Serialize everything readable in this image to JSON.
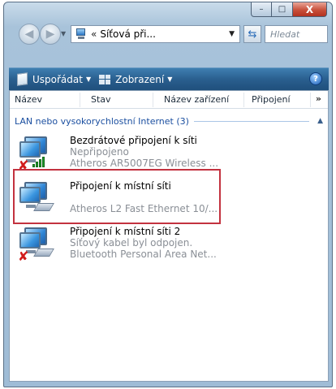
{
  "window": {
    "caption": {
      "minimize": "–",
      "maximize": "□",
      "close": "X"
    }
  },
  "address": {
    "separator": "«",
    "path": "Síťová při...",
    "search_placeholder": "Hledat"
  },
  "toolbar": {
    "organize": "Uspořádat",
    "views": "Zobrazení",
    "help": "?"
  },
  "columns": {
    "name": "Název",
    "status": "Stav",
    "device": "Název zařízení",
    "connection": "Připojení",
    "more": "»"
  },
  "group": {
    "label": "LAN nebo vysokorychlostní Internet (3)"
  },
  "items": [
    {
      "label": "Bezdrátové připojení k síti",
      "status": "Nepřipojeno",
      "device": "Atheros AR5007EG Wireless ...",
      "icon": "wireless-disconnected-icon"
    },
    {
      "label": "Připojení k místní síti",
      "status": "",
      "device": "Atheros L2 Fast Ethernet 10/...",
      "icon": "lan-connection-icon"
    },
    {
      "label": "Připojení k místní síti 2",
      "status": "Síťový kabel byl odpojen.",
      "device": "Bluetooth Personal Area Net...",
      "icon": "lan-disconnected-icon"
    }
  ],
  "colors": {
    "toolbar": "#2a5f8f",
    "group_text": "#1b4fa0",
    "highlight": "#c3323f"
  }
}
